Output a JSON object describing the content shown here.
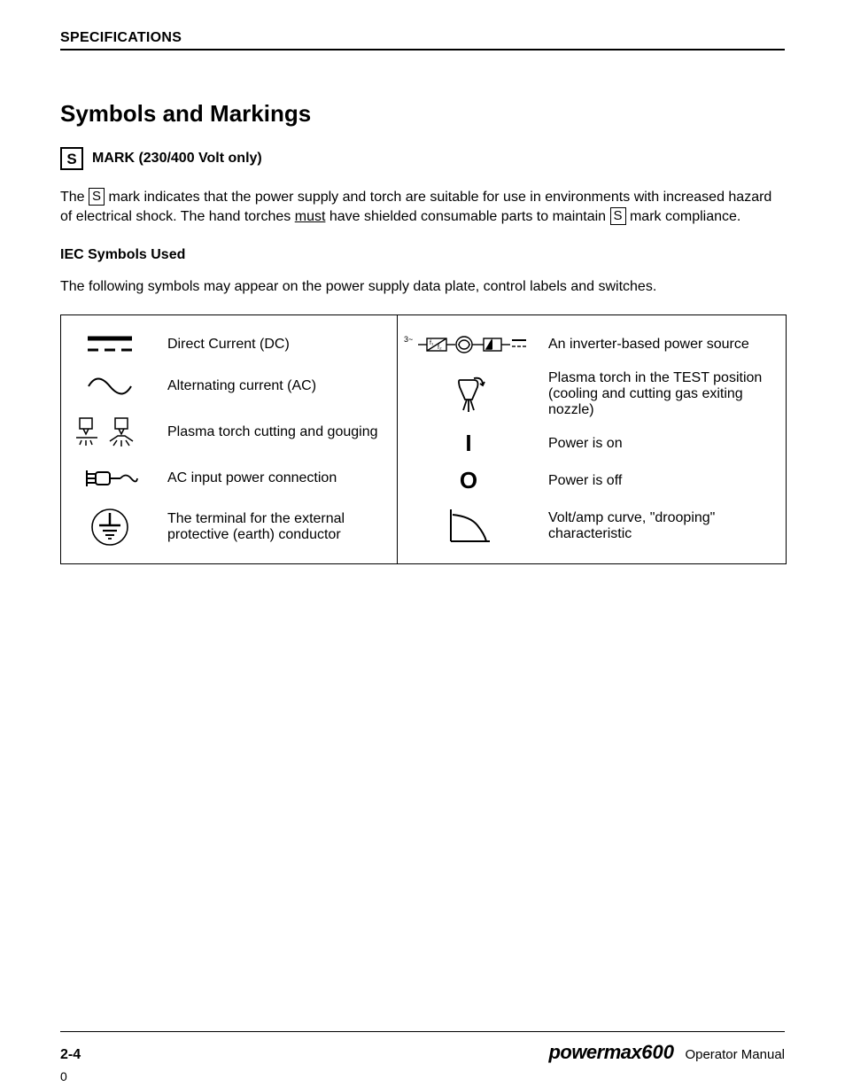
{
  "header": {
    "section": "SPECIFICATIONS"
  },
  "title": "Symbols and Markings",
  "smark_heading": "MARK (230/400 Volt only)",
  "smark_para_before_s1": "The ",
  "smark_para_mid": " mark indicates that the power supply and torch are suitable for use in environments with increased hazard of electrical shock.  The hand torches ",
  "smark_para_must": "must",
  "smark_para_after_must": " have shielded consumable parts to maintain ",
  "smark_para_tail": " mark compliance.",
  "iec_heading": "IEC Symbols Used",
  "iec_para": "The following symbols may appear on the power supply data plate, control labels and switches.",
  "left_rows": [
    "Direct Current (DC)",
    "Alternating current (AC)",
    "Plasma torch cutting and gouging",
    "AC input power connection",
    "The terminal for the external protective (earth) conductor"
  ],
  "right_rows": [
    "An inverter-based power source",
    "Plasma torch in the TEST position (cooling and cutting gas exiting nozzle)",
    "Power is on",
    "Power is off",
    "Volt/amp curve, \"drooping\" characteristic"
  ],
  "right_glyphs": {
    "on": "I",
    "off": "O"
  },
  "footer": {
    "page": "2-4",
    "brand": "powermax",
    "model": "600",
    "manual": "Operator Manual",
    "stray": "0"
  }
}
